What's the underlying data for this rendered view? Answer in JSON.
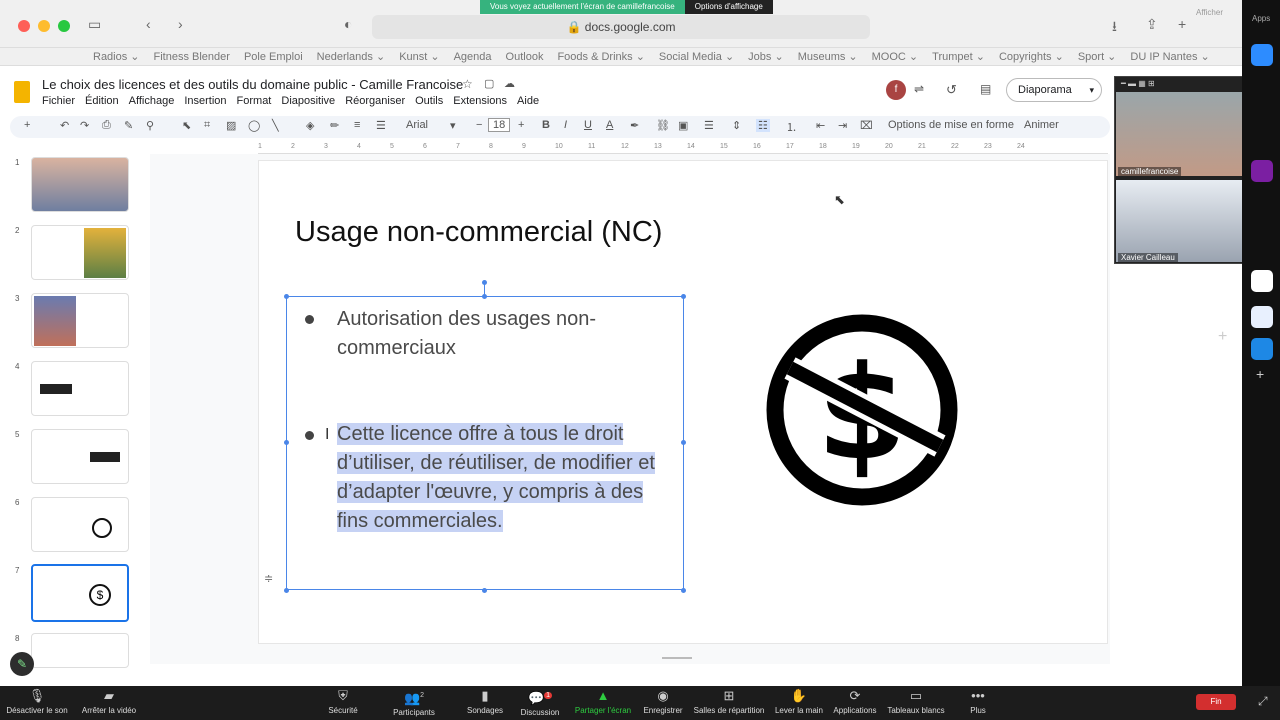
{
  "zoom_share": {
    "banner": "Vous voyez actuellement l'écran de camillefrancoise",
    "options": "Options d'affichage"
  },
  "browser": {
    "url": "docs.google.com",
    "bookmarks": [
      "Radios ⌄",
      "Fitness Blender",
      "Pole Emploi",
      "Nederlands ⌄",
      "Kunst ⌄",
      "Agenda",
      "Outlook",
      "Foods & Drinks ⌄",
      "Social Media ⌄",
      "Jobs ⌄",
      "Museums ⌄",
      "MOOC ⌄",
      "Trumpet ⌄",
      "Copyrights ⌄",
      "Sport ⌄",
      "DU IP Nantes ⌄"
    ],
    "right_label": "Afficher",
    "apps_label": "Apps"
  },
  "doc": {
    "title": "Le choix des licences et des outils du domaine public - Camille Francoise",
    "menu": [
      "Fichier",
      "Édition",
      "Affichage",
      "Insertion",
      "Format",
      "Diapositive",
      "Réorganiser",
      "Outils",
      "Extensions",
      "Aide"
    ],
    "presence_initial": "f",
    "slideshow_label": "Diaporama"
  },
  "toolbar": {
    "font": "Arial",
    "font_size": "18",
    "format_options": "Options de mise en forme",
    "animate": "Animer"
  },
  "ruler": [
    "1",
    "2",
    "3",
    "4",
    "5",
    "6",
    "7",
    "8",
    "9",
    "10",
    "11",
    "12",
    "13",
    "14",
    "15",
    "16",
    "17",
    "18",
    "19",
    "20",
    "21",
    "22",
    "23",
    "24"
  ],
  "filmstrip": [
    {
      "num": "1"
    },
    {
      "num": "2"
    },
    {
      "num": "3"
    },
    {
      "num": "4"
    },
    {
      "num": "5"
    },
    {
      "num": "6"
    },
    {
      "num": "7"
    },
    {
      "num": "8"
    }
  ],
  "slide": {
    "title": "Usage non-commercial (NC)",
    "bullet1": "Autorisation des usages non-commerciaux",
    "bullet2": "Cette licence offre à tous le droit d’utiliser, de réutiliser, de modifier et d’adapter l'œuvre, y compris à des fins commerciales."
  },
  "participants": [
    {
      "name": "camillefrancoise"
    },
    {
      "name": "Xavier Cailleau"
    }
  ],
  "zoom_controls": {
    "mute": "Désactiver le son",
    "video": "Arrêter la vidéo",
    "security": "Sécurité",
    "participants": "Participants",
    "participants_count": "2",
    "polls": "Sondages",
    "chat": "Discussion",
    "chat_badge": "1",
    "share": "Partager l'écran",
    "record": "Enregistrer",
    "breakout": "Salles de répartition",
    "raise_hand": "Lever la main",
    "apps": "Applications",
    "whiteboards": "Tableaux blancs",
    "more": "Plus",
    "end": "Fin"
  },
  "colors": {
    "accent": "#4a86e8",
    "selection": "#c6d2f4",
    "zoom_green": "#36b37e",
    "end_red": "#d32f2f"
  }
}
